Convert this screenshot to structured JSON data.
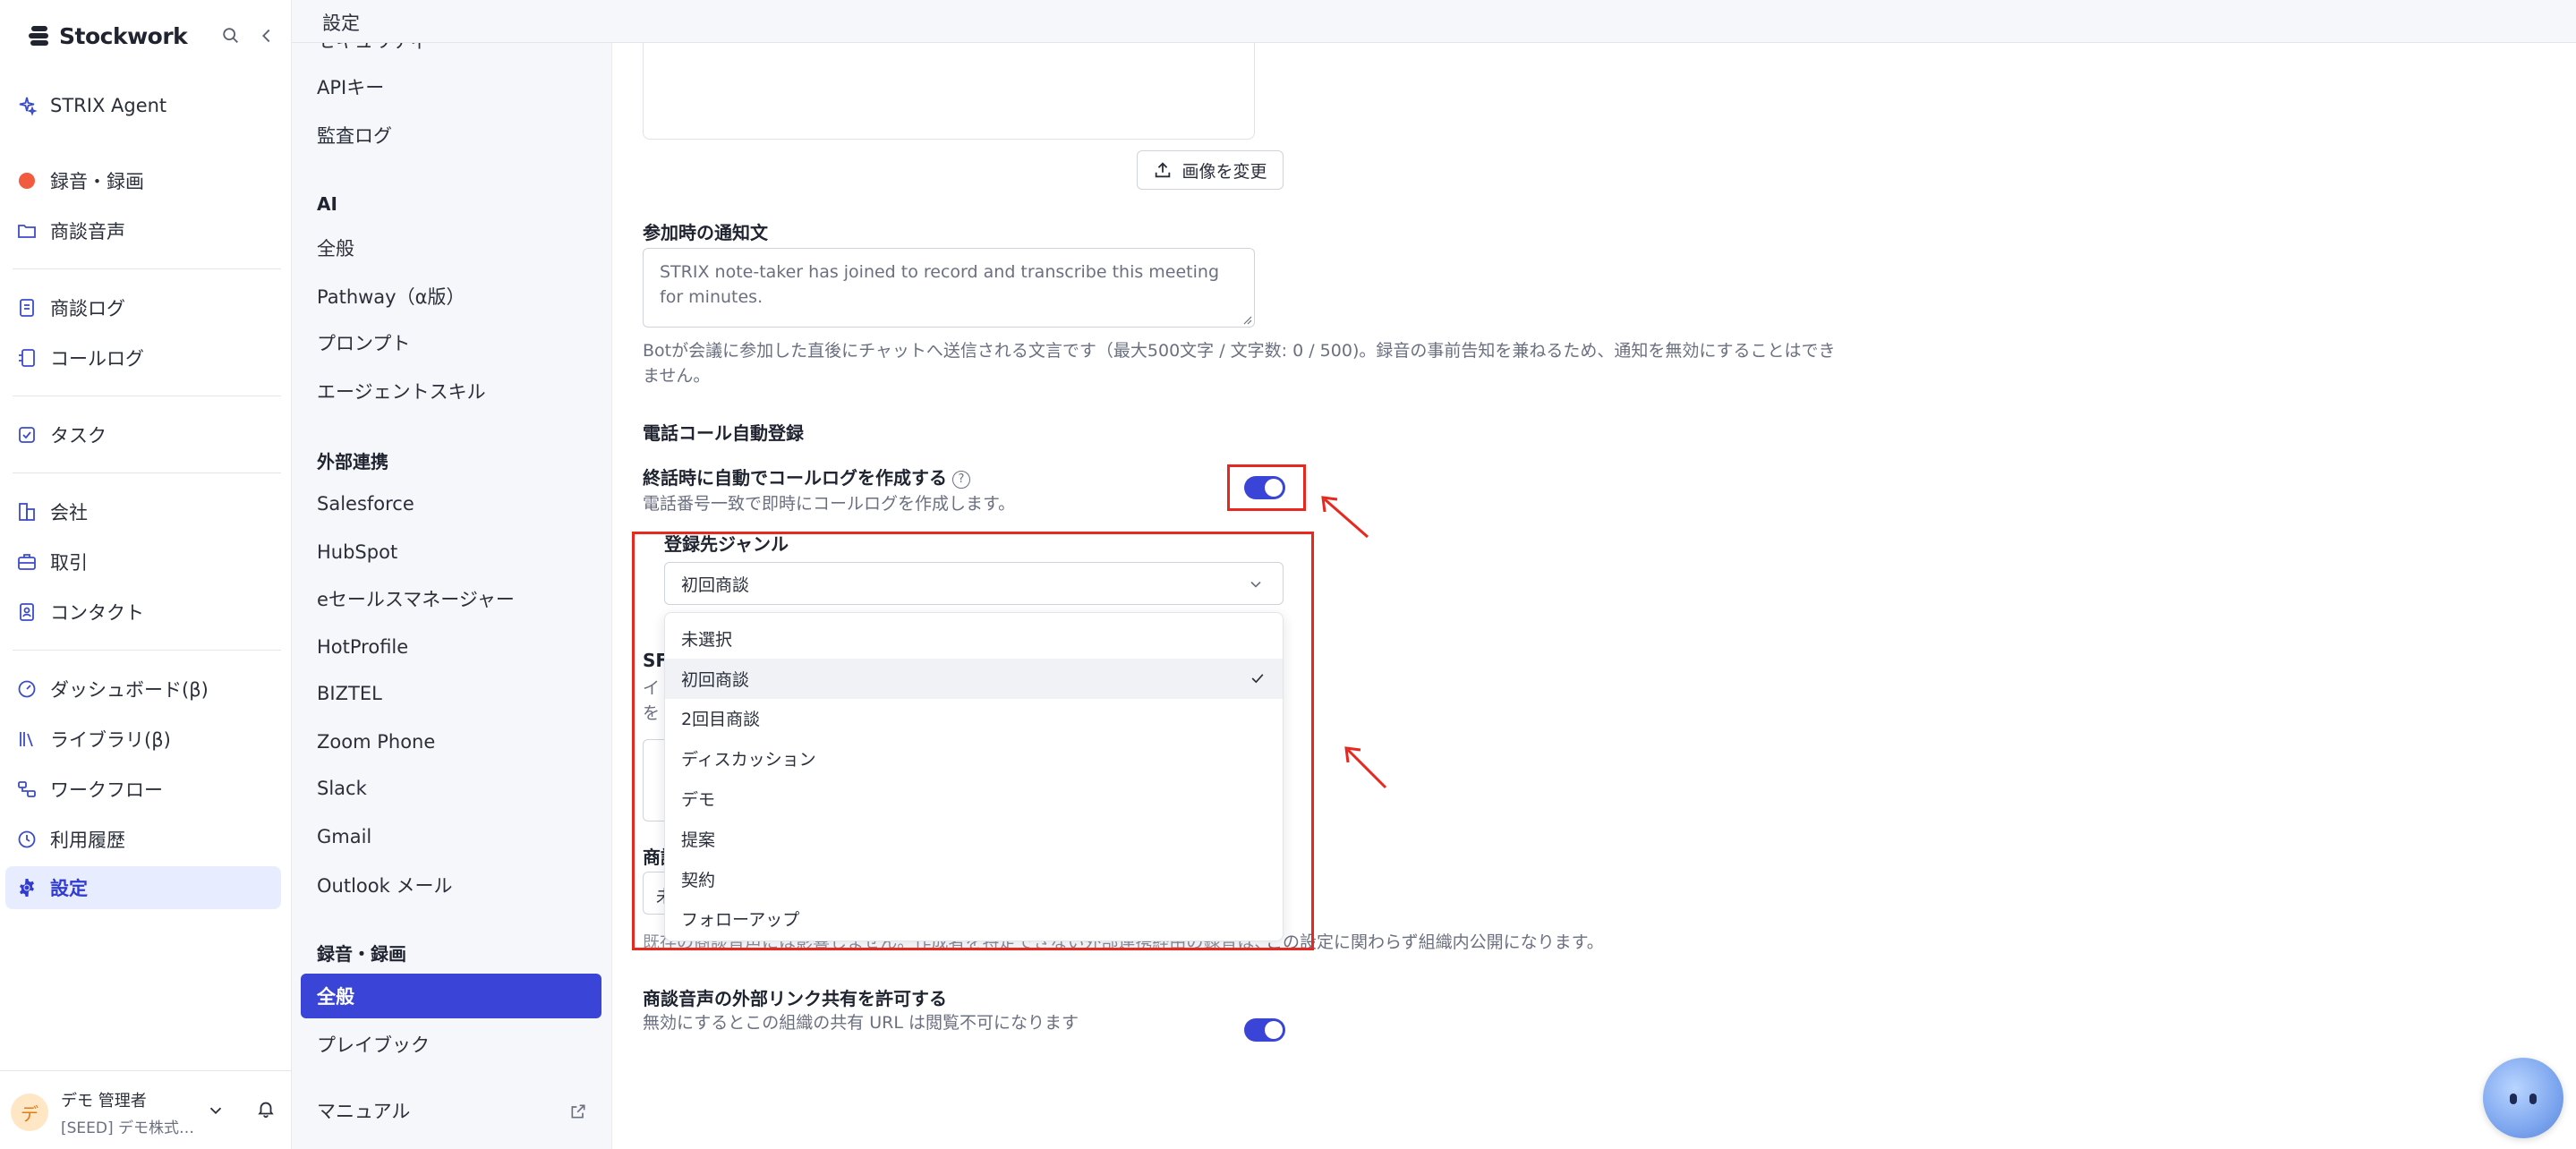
{
  "app": {
    "brand": "Stockwork",
    "header_title": "設定"
  },
  "sidebar": {
    "items": [
      {
        "label": "STRIX Agent"
      },
      {
        "label": "録音・録画"
      },
      {
        "label": "商談音声"
      },
      {
        "label": "商談ログ"
      },
      {
        "label": "コールログ"
      },
      {
        "label": "タスク"
      },
      {
        "label": "会社"
      },
      {
        "label": "取引"
      },
      {
        "label": "コンタクト"
      },
      {
        "label": "ダッシュボード(β)"
      },
      {
        "label": "ライブラリ(β)"
      },
      {
        "label": "ワークフロー"
      },
      {
        "label": "利用履歴"
      },
      {
        "label": "設定"
      }
    ],
    "user": {
      "avatar_initial": "デ",
      "name": "デモ 管理者",
      "org": "[SEED] デモ株式…"
    }
  },
  "settings_menu": {
    "partial_top": "セキュリティ",
    "general_items": [
      "APIキー",
      "監査ログ"
    ],
    "ai": {
      "title": "AI",
      "items": [
        "全般",
        "Pathway（α版）",
        "プロンプト",
        "エージェントスキル"
      ]
    },
    "integrations": {
      "title": "外部連携",
      "items": [
        "Salesforce",
        "HubSpot",
        "eセールスマネージャー",
        "HotProfile",
        "BIZTEL",
        "Zoom Phone",
        "Slack",
        "Gmail",
        "Outlook メール"
      ]
    },
    "recording": {
      "title": "録音・録画",
      "items": [
        "全般",
        "プレイブック"
      ]
    },
    "manual": "マニュアル"
  },
  "main": {
    "change_image_button": "画像を変更",
    "join_notice": {
      "label": "参加時の通知文",
      "value": "STRIX note-taker has joined to record and transcribe this meeting for minutes.",
      "help_line1": "Botが会議に参加した直後にチャットへ送信される文言です（最大500文字 / 文字数: 0 / 500)。録音の事前告知を兼ねるため、通知を無効にすることはでき",
      "help_line2": "ません。"
    },
    "auto_call": {
      "section_title": "電話コール自動登録",
      "toggle_label": "終話時に自動でコールログを作成する",
      "toggle_desc": "電話番号一致で即時にコールログを作成します。",
      "toggle_on": true,
      "genre_label": "登録先ジャンル",
      "genre_selected": "初回商談",
      "options": [
        "未選択",
        "初回商談",
        "2回目商談",
        "ディスカッション",
        "デモ",
        "提案",
        "契約",
        "フォローアップ"
      ]
    },
    "hidden_fragments": {
      "sf_label": "SF",
      "line_a": "イ",
      "line_b": "を",
      "shoudan_label": "商談",
      "select_peek": "未"
    },
    "visibility_note": "既存の商談音声には影響しません。作成者を特定できない外部連携経由の録音は、この設定に関わらず組織内公開になります。",
    "visibility_note_visible": "この設定に関わらず組織内公開になります。",
    "external_share": {
      "label": "商談音声の外部リンク共有を許可する",
      "desc": "無効にするとこの組織の共有 URL は閲覧不可になります",
      "toggle_on": true
    }
  },
  "colors": {
    "accent": "#3a45d8",
    "annotation_red": "#e8281e",
    "record_dot": "#f25b3e"
  }
}
